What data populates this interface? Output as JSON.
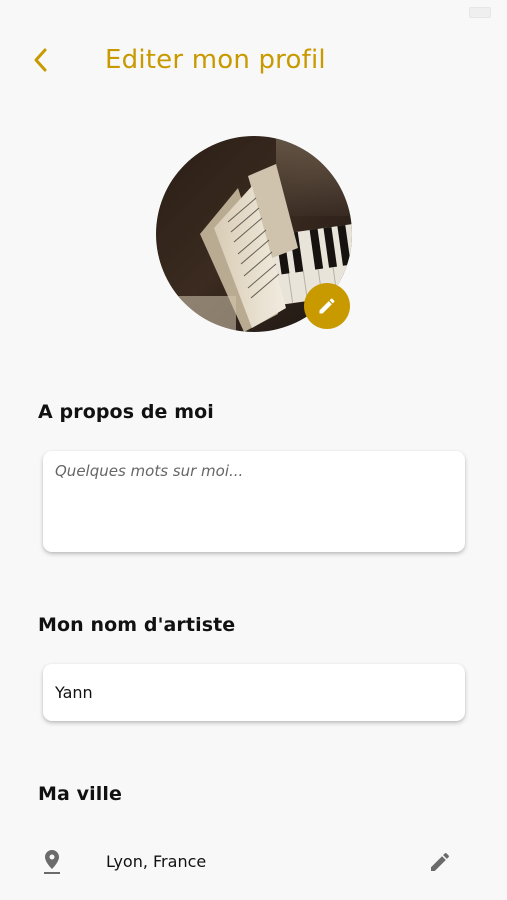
{
  "header": {
    "title": "Editer mon profil",
    "back_icon": "chevron-left-icon"
  },
  "avatar": {
    "image_subject": "sheet music on piano",
    "edit_icon": "pencil-icon"
  },
  "about": {
    "heading": "A propos de moi",
    "placeholder": "Quelques mots sur moi...",
    "value": ""
  },
  "artist_name": {
    "heading": "Mon nom d'artiste",
    "value": "Yann"
  },
  "city": {
    "heading": "Ma ville",
    "value": "Lyon, France",
    "pin_icon": "location-pin-icon",
    "edit_icon": "pencil-icon"
  },
  "colors": {
    "accent": "#c89a00",
    "background": "#f8f8f8",
    "text": "#111111",
    "icon_gray": "#6b6b6b"
  }
}
